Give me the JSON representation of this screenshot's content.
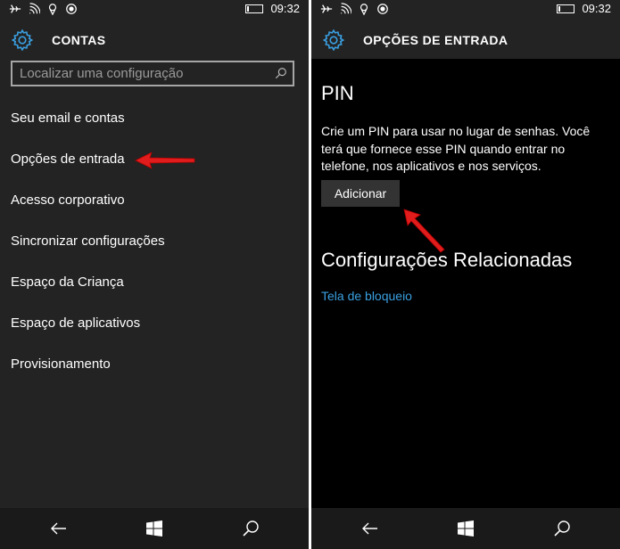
{
  "colors": {
    "accent": "#3a9fe0",
    "annotation_arrow": "#e11c1c"
  },
  "status_bar": {
    "time": "09:32",
    "icons": [
      "airplane-icon",
      "wifi-icon",
      "location-icon",
      "record-icon"
    ]
  },
  "left_screen": {
    "header_title": "CONTAS",
    "header_icon": "gear-icon",
    "search": {
      "placeholder": "Localizar uma configuração"
    },
    "menu_items": [
      "Seu email e contas",
      "Opções de entrada",
      "Acesso corporativo",
      "Sincronizar configurações",
      "Espaço da Criança",
      "Espaço de aplicativos",
      "Provisionamento"
    ],
    "battery_level": 0.1
  },
  "right_screen": {
    "header_title": "OPÇÕES DE ENTRADA",
    "header_icon": "gear-icon",
    "pin_title": "PIN",
    "pin_description": "Crie um PIN para usar no lugar de senhas. Você terá que fornece esse PIN quando entrar no telefone, nos aplicativos e nos serviços.",
    "add_button": "Adicionar",
    "related_title": "Configurações Relacionadas",
    "lock_screen_link": "Tela de bloqueio",
    "battery_level": 0.1
  },
  "nav_bar": {
    "icons": [
      "back-icon",
      "windows-start-icon",
      "search-icon"
    ]
  }
}
